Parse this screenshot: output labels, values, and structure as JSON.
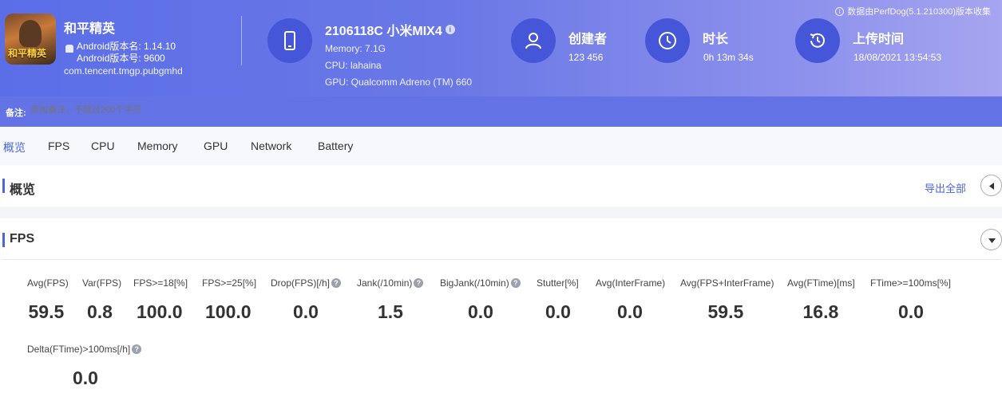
{
  "notice": "数据由PerfDog(5.1.210300)版本收集",
  "app": {
    "name": "和平精英",
    "version_name": "Android版本名: 1.14.10",
    "version_code": "Android版本号: 9600",
    "package": "com.tencent.tmgp.pubgmhd",
    "icon_text": "和平精英"
  },
  "device": {
    "title": "2106118C 小米MIX4",
    "memory": "Memory: 7.1G",
    "cpu": "CPU: lahaina",
    "gpu": "GPU: Qualcomm Adreno (TM) 660"
  },
  "stats": {
    "creator_label": "创建者",
    "creator_value": "123 456",
    "duration_label": "时长",
    "duration_value": "0h 13m 34s",
    "upload_label": "上传时间",
    "upload_value": "18/08/2021 13:54:53"
  },
  "remark": {
    "label": "备注:",
    "placeholder": "添加备注，不超过200个字符"
  },
  "tabs": [
    "概览",
    "FPS",
    "CPU",
    "Memory",
    "GPU",
    "Network",
    "Battery"
  ],
  "overview": {
    "title": "概览",
    "export_label": "导出全部"
  },
  "fps_panel": {
    "title": "FPS",
    "metrics": [
      {
        "label": "Avg(FPS)",
        "value": "59.5",
        "help": false
      },
      {
        "label": "Var(FPS)",
        "value": "0.8",
        "help": false
      },
      {
        "label": "FPS>=18[%]",
        "value": "100.0",
        "help": false
      },
      {
        "label": "FPS>=25[%]",
        "value": "100.0",
        "help": false
      },
      {
        "label": "Drop(FPS)[/h]",
        "value": "0.0",
        "help": true
      },
      {
        "label": "Jank(/10min)",
        "value": "1.5",
        "help": true
      },
      {
        "label": "BigJank(/10min)",
        "value": "0.0",
        "help": true
      },
      {
        "label": "Stutter[%]",
        "value": "0.0",
        "help": false
      },
      {
        "label": "Avg(InterFrame)",
        "value": "0.0",
        "help": false
      },
      {
        "label": "Avg(FPS+InterFrame)",
        "value": "59.5",
        "help": false
      },
      {
        "label": "Avg(FTime)[ms]",
        "value": "16.8",
        "help": false
      },
      {
        "label": "FTime>=100ms[%]",
        "value": "0.0",
        "help": false
      },
      {
        "label": "Delta(FTime)>100ms[/h]",
        "value": "0.0",
        "help": true
      }
    ]
  }
}
